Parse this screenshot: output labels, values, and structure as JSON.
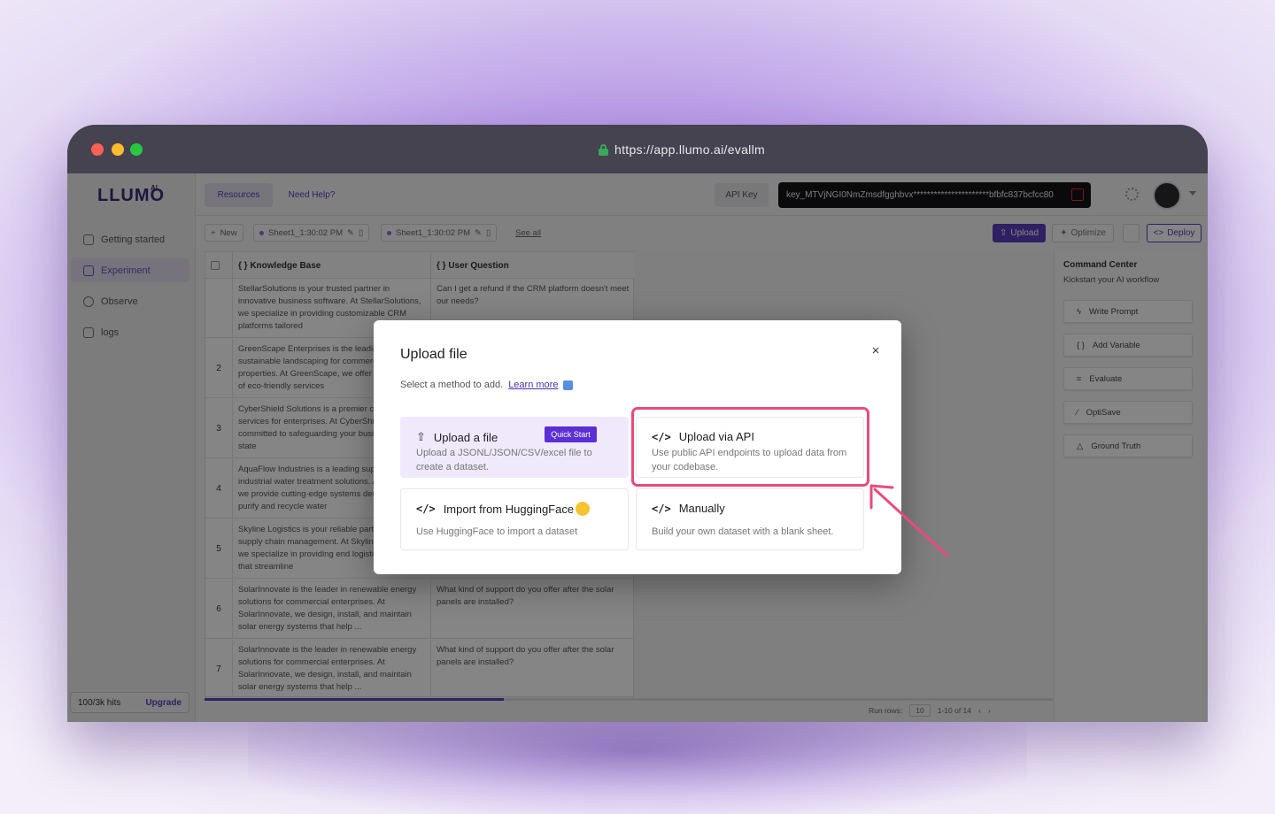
{
  "browser": {
    "url": "https://app.llumo.ai/evallm"
  },
  "sidebar": {
    "logo": "LLUMO",
    "logo_sup": "AI",
    "items": [
      {
        "label": "Getting started",
        "icon": "rocket-icon"
      },
      {
        "label": "Experiment",
        "icon": "grid-icon",
        "active": true
      },
      {
        "label": "Observe",
        "icon": "gauge-icon"
      },
      {
        "label": "logs",
        "icon": "logs-icon"
      }
    ],
    "hits": "100/3k hits",
    "upgrade": "Upgrade"
  },
  "topbar": {
    "resources": "Resources",
    "need_help": "Need Help?",
    "api_key_label": "API Key",
    "api_key_value": "key_MTVjNGI0NmZmsdfgghbvx**********************bfbfc837bcfcc80"
  },
  "tabs": {
    "new": "New",
    "sheet1": "Sheet1_1:30:02 PM",
    "sheet2": "Sheet1_1:30:02 PM",
    "see_all": "See all",
    "upload": "Upload",
    "optimize": "Optimize",
    "deploy": "Deploy"
  },
  "table": {
    "columns": [
      "{ } Knowledge Base",
      "{ } User Question"
    ],
    "rows": [
      {
        "n": "",
        "kb": "StellarSolutions is your trusted partner in innovative business software. At StellarSolutions, we specialize in providing customizable CRM platforms tailored",
        "q": "Can I get a refund if the CRM platform doesn't meet our needs?"
      },
      {
        "n": "2",
        "kb": "GreenScape Enterprises is the leading provider of sustainable landscaping for commercial properties. At GreenScape, we offer a full range of eco-friendly services",
        "q": ""
      },
      {
        "n": "3",
        "kb": "CyberShield Solutions is a premier cybersecurity services for enterprises. At CyberShield, we are committed to safeguarding your business with state",
        "q": ""
      },
      {
        "n": "4",
        "kb": "AquaFlow Industries is a leading supplier of industrial water treatment solutions. At AquaFlow, we provide cutting-edge systems designed to purify and recycle water",
        "q": ""
      },
      {
        "n": "5",
        "kb": "Skyline Logistics is your reliable partner in global supply chain management. At Skyline Logistics, we specialize in providing end logistics solutions that streamline",
        "q": ""
      },
      {
        "n": "6",
        "kb": "SolarInnovate is the leader in renewable energy solutions for commercial enterprises. At SolarInnovate, we design, install, and maintain solar energy systems that help ...",
        "q": "What kind of support do you offer after the solar panels are installed?"
      },
      {
        "n": "7",
        "kb": "SolarInnovate is the leader in renewable energy solutions for commercial enterprises. At SolarInnovate, we design, install, and maintain solar energy systems that help ...",
        "q": "What kind of support do you offer after the solar panels are installed?"
      }
    ]
  },
  "pager": {
    "run_rows_label": "Run rows:",
    "run_rows_value": "10",
    "range": "1-10 of 14"
  },
  "command_center": {
    "title": "Command Center",
    "subtitle": "Kickstart your AI workflow",
    "items": [
      "Write Prompt",
      "Add Variable",
      "Evaluate",
      "OptiSave",
      "Ground Truth"
    ]
  },
  "modal": {
    "title": "Upload file",
    "close": "×",
    "subtitle": "Select a method to add.",
    "learn_more": "Learn more",
    "options": {
      "file": {
        "title": "Upload a file",
        "badge": "Quick Start",
        "desc": "Upload a JSONL/JSON/CSV/excel file to create a dataset."
      },
      "api": {
        "title": "Upload via API",
        "desc": "Use public API endpoints to upload data from your codebase."
      },
      "hf": {
        "title": "Import from HuggingFace",
        "desc": "Use HuggingFace to import a dataset"
      },
      "manual": {
        "title": "Manually",
        "desc": "Build your own dataset with a blank sheet."
      }
    }
  },
  "colors": {
    "accent": "#5a3fbf",
    "highlight": "#e94b7b",
    "badge": "#5a2fd6"
  }
}
